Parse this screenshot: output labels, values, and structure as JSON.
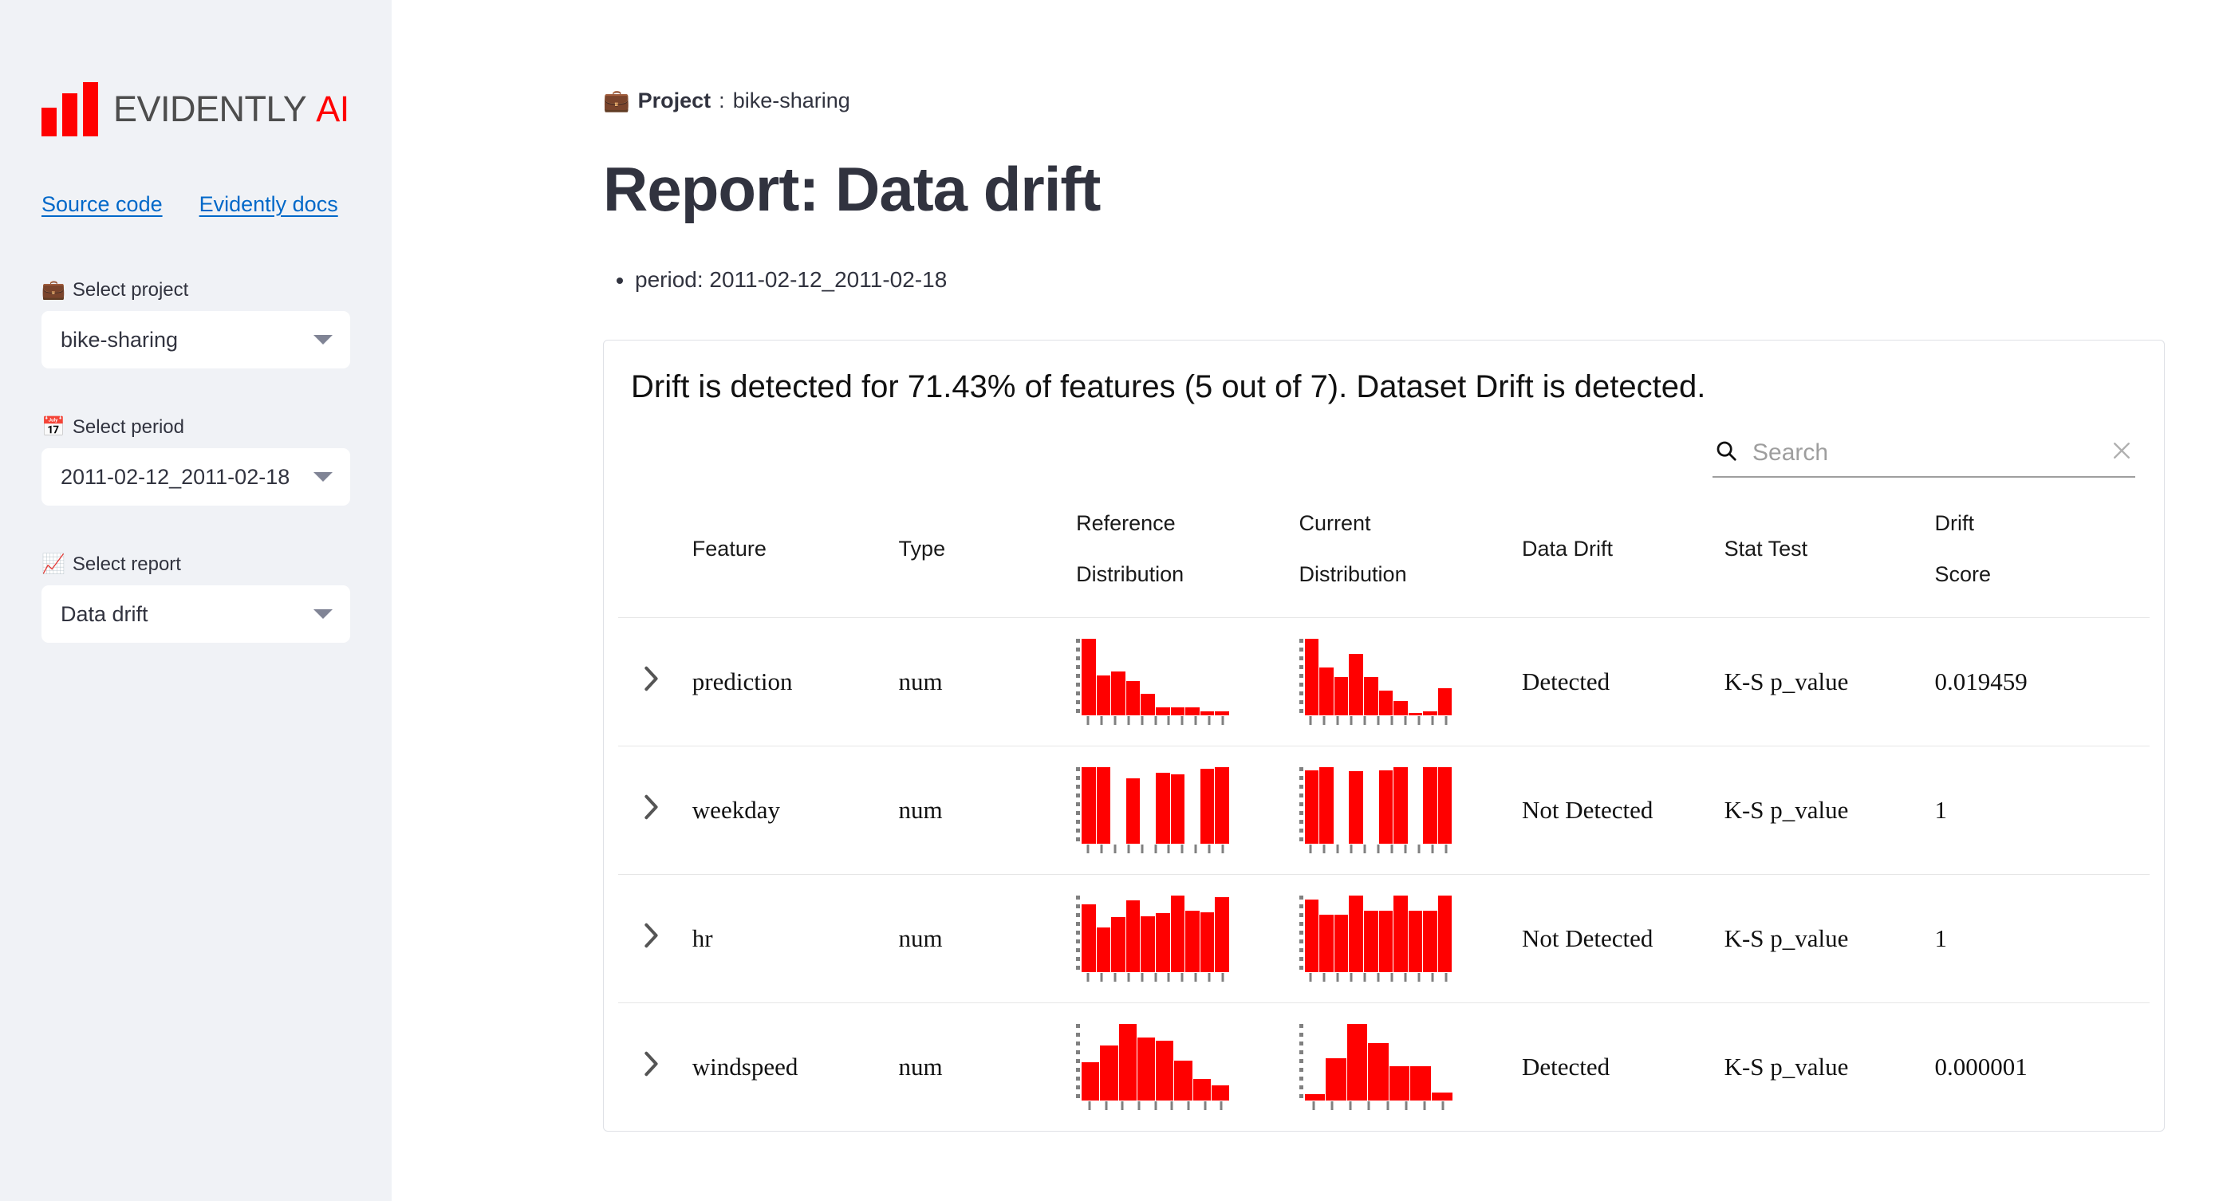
{
  "sidebar": {
    "logo": {
      "name_main": "EVIDENTLY",
      "name_accent": "AI",
      "accent_color": "#ff0000",
      "text_color": "#4d4d4d"
    },
    "links": [
      {
        "label": "Source code"
      },
      {
        "label": "Evidently docs"
      }
    ],
    "fields": [
      {
        "icon": "briefcase-emoji",
        "glyph": "💼",
        "label": "Select project",
        "value": "bike-sharing"
      },
      {
        "icon": "calendar-emoji",
        "glyph": "📅",
        "label": "Select period",
        "value": "2011-02-12_2011-02-18"
      },
      {
        "icon": "chart-increasing-emoji",
        "glyph": "📈",
        "label": "Select report",
        "value": "Data drift"
      }
    ]
  },
  "main": {
    "project_icon_glyph": "💼",
    "project_label": "Project",
    "project_sep": ":",
    "project_value": "bike-sharing",
    "title_lead": "Report: ",
    "title_strong": "Data drift",
    "bullets": [
      "period: 2011-02-12_2011-02-18"
    ],
    "card": {
      "heading": "Drift is detected for 71.43% of features (5 out of 7). Dataset Drift is detected.",
      "search": {
        "placeholder": "Search",
        "value": "",
        "search_icon": "search-icon",
        "clear_icon": "close-icon"
      },
      "columns": [
        {
          "key": "expand",
          "label": ""
        },
        {
          "key": "feature",
          "label": "Feature"
        },
        {
          "key": "type",
          "label": "Type"
        },
        {
          "key": "reference",
          "label_line1": "Reference",
          "label_line2": "Distribution"
        },
        {
          "key": "current",
          "label_line1": "Current",
          "label_line2": "Distribution"
        },
        {
          "key": "drift",
          "label": "Data Drift"
        },
        {
          "key": "stat",
          "label": "Stat Test"
        },
        {
          "key": "score",
          "label_line1": "Drift",
          "label_line2": "Score"
        }
      ],
      "rows": [
        {
          "expand_icon": "chevron-right-icon",
          "feature": "prediction",
          "type": "num",
          "data_drift": "Detected",
          "stat_test": "K-S p_value",
          "drift_score": "0.019459"
        },
        {
          "expand_icon": "chevron-right-icon",
          "feature": "weekday",
          "type": "num",
          "data_drift": "Not Detected",
          "stat_test": "K-S p_value",
          "drift_score": "1"
        },
        {
          "expand_icon": "chevron-right-icon",
          "feature": "hr",
          "type": "num",
          "data_drift": "Not Detected",
          "stat_test": "K-S p_value",
          "drift_score": "1"
        },
        {
          "expand_icon": "chevron-right-icon",
          "feature": "windspeed",
          "type": "num",
          "data_drift": "Detected",
          "stat_test": "K-S p_value",
          "drift_score": "0.000001"
        }
      ]
    }
  },
  "chart_data": [
    {
      "type": "bar",
      "title": "prediction reference distribution",
      "bar_color": "#ff0000",
      "ylim": [
        0,
        100
      ],
      "values": [
        100,
        52,
        57,
        45,
        28,
        10,
        10,
        10,
        5,
        5
      ]
    },
    {
      "type": "bar",
      "title": "prediction current distribution",
      "bar_color": "#ff0000",
      "ylim": [
        0,
        100
      ],
      "values": [
        100,
        62,
        50,
        80,
        50,
        32,
        18,
        3,
        5,
        35
      ]
    },
    {
      "type": "bar",
      "title": "weekday reference distribution",
      "bar_color": "#ff0000",
      "ylim": [
        0,
        100
      ],
      "values": [
        100,
        100,
        0,
        85,
        0,
        92,
        90,
        0,
        98,
        100
      ]
    },
    {
      "type": "bar",
      "title": "weekday current distribution",
      "bar_color": "#ff0000",
      "ylim": [
        0,
        100
      ],
      "values": [
        96,
        100,
        0,
        95,
        0,
        96,
        100,
        0,
        100,
        100
      ]
    },
    {
      "type": "bar",
      "title": "hr reference distribution",
      "bar_color": "#ff0000",
      "ylim": [
        0,
        100
      ],
      "values": [
        88,
        58,
        72,
        93,
        73,
        77,
        100,
        80,
        78,
        98
      ]
    },
    {
      "type": "bar",
      "title": "hr current distribution",
      "bar_color": "#ff0000",
      "ylim": [
        0,
        100
      ],
      "values": [
        95,
        75,
        75,
        100,
        80,
        80,
        100,
        80,
        80,
        100
      ]
    },
    {
      "type": "bar",
      "title": "windspeed reference distribution",
      "bar_color": "#ff0000",
      "ylim": [
        0,
        100
      ],
      "values": [
        50,
        72,
        100,
        82,
        78,
        52,
        28,
        20
      ]
    },
    {
      "type": "bar",
      "title": "windspeed current distribution",
      "bar_color": "#ff0000",
      "ylim": [
        0,
        100
      ],
      "values": [
        8,
        55,
        100,
        75,
        45,
        45,
        10
      ]
    }
  ]
}
